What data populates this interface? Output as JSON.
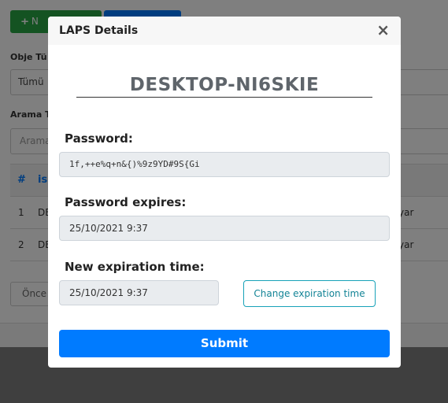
{
  "background": {
    "new_button_label": "N",
    "filter_label": "Obje Tü",
    "filter_value": "Tümü",
    "search_label": "Arama T",
    "search_placeholder": "Arama",
    "table_headers": [
      "#",
      "is"
    ],
    "rows": [
      {
        "num": "1",
        "name": "DE",
        "tail": "yar"
      },
      {
        "num": "2",
        "name": "DE",
        "tail": "yar"
      }
    ],
    "prev_button": "Önce"
  },
  "modal": {
    "title": "LAPS Details",
    "close_symbol": "×",
    "computer_name": "DESKTOP-NI6SKIE",
    "password_label": "Password:",
    "password_value": "1f,++e%q+n&{)%9z9YD#9S{Gi",
    "expires_label": "Password expires:",
    "expires_value": "25/10/2021 9:37",
    "new_expiration_label": "New expiration time:",
    "new_expiration_value": "25/10/2021 9:37",
    "change_button": "Change expiration time",
    "submit_button": "Submit"
  }
}
